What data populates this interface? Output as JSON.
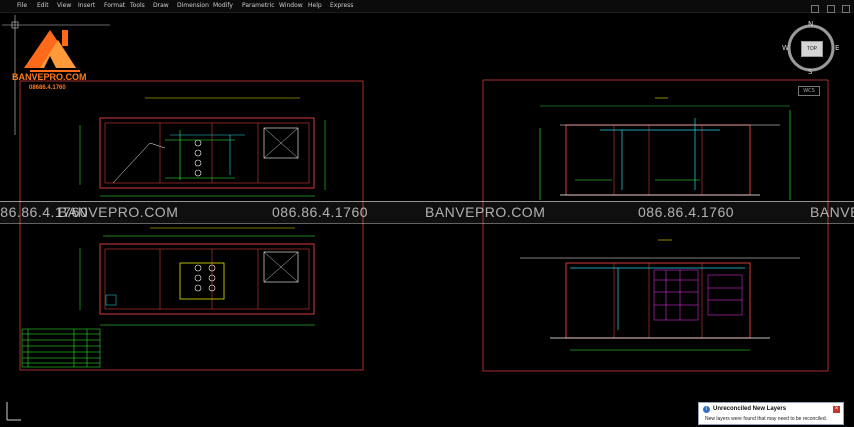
{
  "menu": {
    "items": [
      "File",
      "Edit",
      "View",
      "Insert",
      "Format",
      "Tools",
      "Draw",
      "Dimension",
      "Modify",
      "Parametric",
      "Window",
      "Help",
      "Express"
    ]
  },
  "logo": {
    "name": "BANVEPRO.COM",
    "phone": "08686.4.1760"
  },
  "watermark": {
    "site": "BANVEPRO.COM",
    "phone": "086.86.4.1760"
  },
  "viewcube": {
    "top": "TOP",
    "north": "N",
    "south": "S",
    "east": "E",
    "west": "W",
    "wcs": "WCS"
  },
  "notification": {
    "title": "Unreconciled New Layers",
    "body": "New layers were found that may need to be reconciled."
  },
  "colors": {
    "background": "#000000",
    "frame": "#d23a3a",
    "line_green": "#33ff33",
    "line_cyan": "#29d7e8",
    "line_magenta": "#ff33ff",
    "accent": "#ff7a1a"
  },
  "icons": [
    "house-logo-icon",
    "viewcube-icon",
    "info-icon",
    "close-icon",
    "ucs-icon"
  ]
}
